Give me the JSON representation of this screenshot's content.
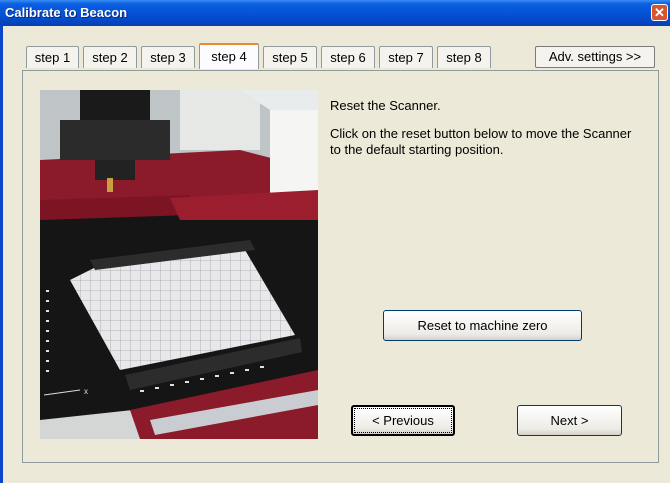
{
  "window": {
    "title": "Calibrate to Beacon"
  },
  "tabs": [
    {
      "label": "step 1"
    },
    {
      "label": "step 2"
    },
    {
      "label": "step 3"
    },
    {
      "label": "step 4"
    },
    {
      "label": "step 5"
    },
    {
      "label": "step 6"
    },
    {
      "label": "step 7"
    },
    {
      "label": "step 8"
    }
  ],
  "active_tab": "step 4",
  "adv_settings_label": "Adv. settings >>",
  "content": {
    "heading": "Reset the Scanner.",
    "description": "Click on the reset button below to move the Scanner to the default starting position."
  },
  "buttons": {
    "reset": "Reset to machine zero",
    "previous": "< Previous",
    "next": "Next >"
  },
  "photo": {
    "axis_label": "x"
  },
  "colors": {
    "titlebar": "#0553d8",
    "machine_red": "#8b1a2b",
    "active_tab_accent": "#e68b2c"
  }
}
